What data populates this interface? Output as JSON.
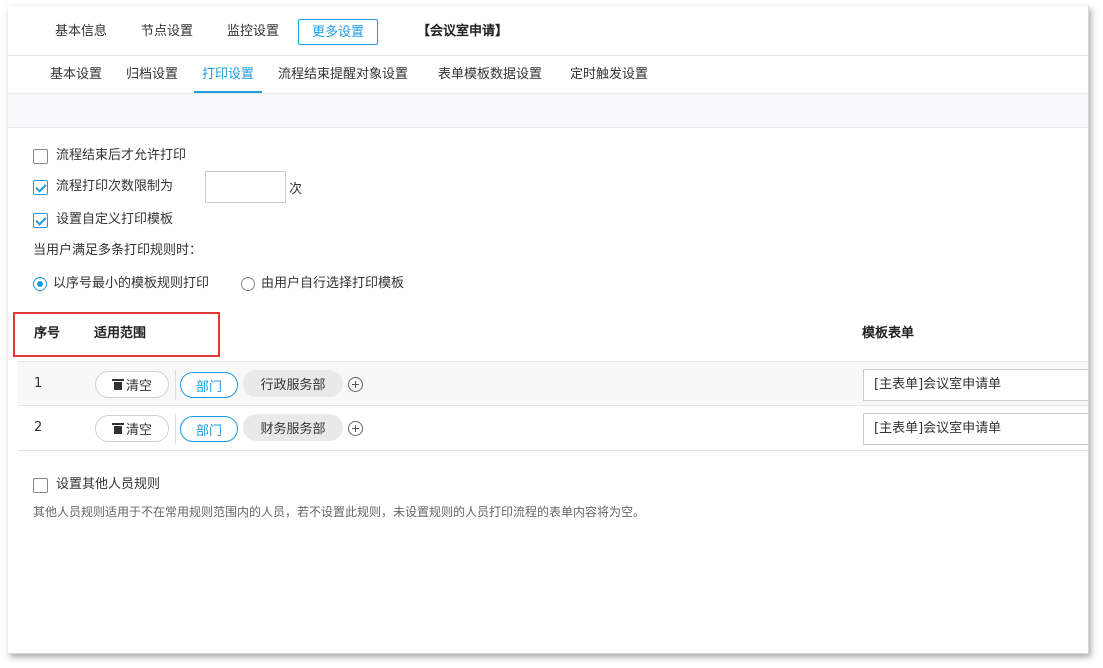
{
  "top_tabs": [
    {
      "label": "基本信息"
    },
    {
      "label": "节点设置"
    },
    {
      "label": "监控设置"
    },
    {
      "label": "更多设置"
    }
  ],
  "form_title": "【会议室申请】",
  "sub_tabs": [
    {
      "label": "基本设置"
    },
    {
      "label": "归档设置"
    },
    {
      "label": "打印设置"
    },
    {
      "label": "流程结束提醒对象设置"
    },
    {
      "label": "表单模板数据设置"
    },
    {
      "label": "定时触发设置"
    }
  ],
  "options": {
    "allow_after_end": {
      "label": "流程结束后才允许打印",
      "checked": false
    },
    "limit_times": {
      "label": "流程打印次数限制为",
      "checked": true,
      "value": "",
      "unit": "次"
    },
    "custom_template": {
      "label": "设置自定义打印模板",
      "checked": true
    },
    "multi_rule_label": "当用户满足多条打印规则时：",
    "radio_min_seq": {
      "label": "以序号最小的模板规则打印",
      "checked": true
    },
    "radio_user_choose": {
      "label": "由用户自行选择打印模板",
      "checked": false
    }
  },
  "table": {
    "headers": {
      "seq": "序号",
      "scope": "适用范围",
      "template": "模板表单"
    },
    "rows": [
      {
        "num": "1",
        "clear_label": "清空",
        "tag": "部门",
        "dept": "行政服务部",
        "template": "[主表单]会议室申请单"
      },
      {
        "num": "2",
        "clear_label": "清空",
        "tag": "部门",
        "dept": "财务服务部",
        "template": "[主表单]会议室申请单"
      }
    ]
  },
  "other_rules": {
    "label": "设置其他人员规则",
    "checked": false,
    "note": "其他人员规则适用于不在常用规则范围内的人员，若不设置此规则，未设置规则的人员打印流程的表单内容将为空。"
  },
  "colors": {
    "accent": "#1f9be0",
    "highlight": "#e53935"
  }
}
